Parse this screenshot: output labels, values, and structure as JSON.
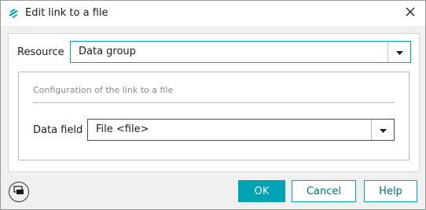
{
  "window": {
    "title": "Edit link to a file",
    "icon": "app-logo-icon",
    "close_icon": "close-icon"
  },
  "resource": {
    "label": "Resource",
    "value": "Data group"
  },
  "group": {
    "title": "Configuration of the link to a file",
    "data_field_label": "Data field",
    "data_field_value": "File <file>"
  },
  "footer": {
    "icon": "window-mode-icon",
    "ok_label": "OK",
    "cancel_label": "Cancel",
    "help_label": "Help"
  },
  "colors": {
    "accent": "#00a3b4",
    "dialog_bg": "#f0f0f0",
    "panel_bg": "#ffffff"
  }
}
